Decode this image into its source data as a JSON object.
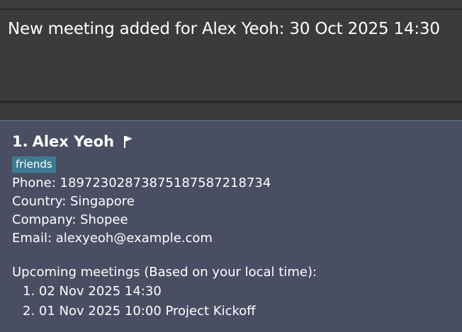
{
  "result": {
    "message": "New meeting added for Alex Yeoh: 30 Oct 2025 14:30"
  },
  "person": {
    "index": "1.",
    "name": "Alex Yeoh",
    "flag_icon": "flag-icon",
    "tags": [
      "friends"
    ],
    "phone": "Phone: 18972302873875187587218734",
    "country": "Country: Singapore",
    "company": "Company: Shopee",
    "email": "Email: alexyeoh@example.com",
    "meetings_header": "Upcoming meetings (Based on your local time):",
    "meetings": [
      "1. 02 Nov 2025 14:30",
      "2. 01 Nov 2025 10:00 Project Kickoff"
    ]
  },
  "colors": {
    "result_bg": "#3b3b3b",
    "card_bg": "#4a4e63",
    "tag_bg": "#3e7b91",
    "text": "#ffffff"
  }
}
